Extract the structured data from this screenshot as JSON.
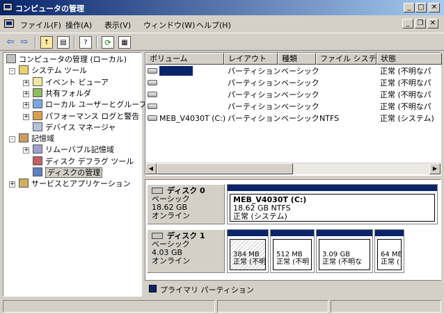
{
  "window": {
    "title": "コンピュータの管理"
  },
  "menu": [
    "ファイル(F)",
    "操作(A)",
    "表示(V)",
    "ウィンドウ(W)",
    "ヘルプ(H)"
  ],
  "tree": [
    {
      "label": "コンピュータの管理 (ローカル)",
      "icon": "computer-icon",
      "level": 0,
      "expander": ""
    },
    {
      "label": "システム ツール",
      "icon": "tools-icon",
      "level": 1,
      "expander": "-"
    },
    {
      "label": "イベント ビューア",
      "icon": "event-viewer-icon",
      "level": 2,
      "expander": "+"
    },
    {
      "label": "共有フォルダ",
      "icon": "shared-folder-icon",
      "level": 2,
      "expander": "+"
    },
    {
      "label": "ローカル ユーザーとグループ",
      "icon": "users-icon",
      "level": 2,
      "expander": "+"
    },
    {
      "label": "パフォーマンス ログと警告",
      "icon": "performance-icon",
      "level": 2,
      "expander": "+"
    },
    {
      "label": "デバイス マネージャ",
      "icon": "device-manager-icon",
      "level": 2,
      "expander": ""
    },
    {
      "label": "記憶域",
      "icon": "storage-icon",
      "level": 1,
      "expander": "-"
    },
    {
      "label": "リムーバブル記憶域",
      "icon": "removable-storage-icon",
      "level": 2,
      "expander": "+"
    },
    {
      "label": "ディスク デフラグ ツール",
      "icon": "defrag-icon",
      "level": 2,
      "expander": ""
    },
    {
      "label": "ディスクの管理",
      "icon": "disk-management-icon",
      "level": 2,
      "expander": "",
      "selected": true
    },
    {
      "label": "サービスとアプリケーション",
      "icon": "services-icon",
      "level": 1,
      "expander": "+"
    }
  ],
  "volume_list": {
    "columns": [
      "ボリューム",
      "レイアウト",
      "種類",
      "ファイル システム",
      "状態"
    ],
    "rows": [
      [
        "",
        "パーティション",
        "ベーシック",
        "",
        "正常 (不明なパ"
      ],
      [
        "",
        "パーティション",
        "ベーシック",
        "",
        "正常 (不明なパ"
      ],
      [
        "",
        "パーティション",
        "ベーシック",
        "",
        "正常 (不明なパ"
      ],
      [
        "",
        "パーティション",
        "ベーシック",
        "",
        "正常 (不明なパ"
      ],
      [
        "MEB_V4030T (C:)",
        "パーティション",
        "ベーシック",
        "NTFS",
        "正常 (システム)"
      ]
    ]
  },
  "disks": [
    {
      "name": "ディスク 0",
      "type": "ベーシック",
      "size": "18.62 GB",
      "status": "オンライン",
      "partitions": [
        {
          "title": "MEB_V4030T  (C:)",
          "line1": "18.62 GB NTFS",
          "line2": "正常 (システム)"
        }
      ]
    },
    {
      "name": "ディスク 1",
      "type": "ベーシック",
      "size": "4.03 GB",
      "status": "オンライン",
      "partitions": [
        {
          "title": "",
          "line1": "384 MB",
          "line2": "正常 (不明"
        },
        {
          "title": "",
          "line1": "512 MB",
          "line2": "正常 (不明"
        },
        {
          "title": "",
          "line1": "3.09 GB",
          "line2": "正常 (不明な"
        },
        {
          "title": "",
          "line1": "64 ME",
          "line2": "正常 ("
        }
      ]
    }
  ],
  "legend": {
    "label": "プライマリ パーティション",
    "color": "#0a246a"
  }
}
